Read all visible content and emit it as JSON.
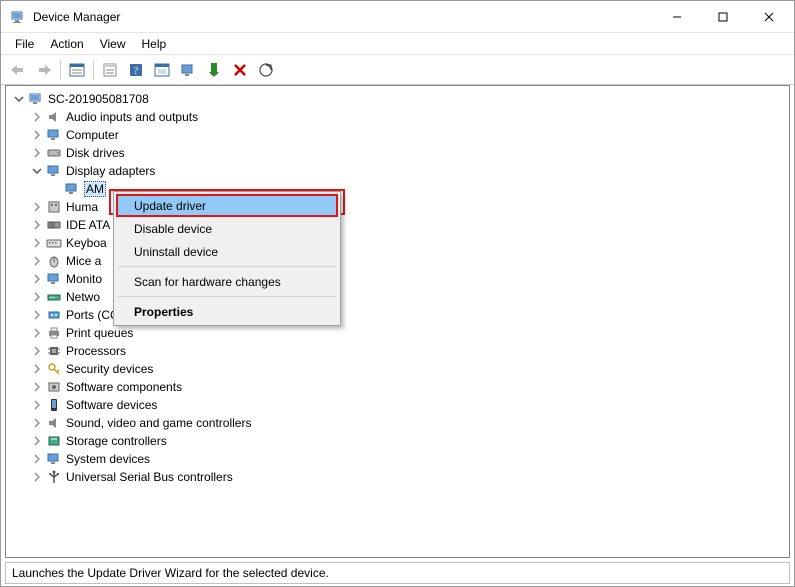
{
  "window": {
    "title": "Device Manager"
  },
  "menubar": [
    "File",
    "Action",
    "View",
    "Help"
  ],
  "toolbar_icons": [
    "back",
    "forward",
    "sep",
    "show-hidden",
    "sep",
    "properties",
    "help",
    "update",
    "monitor",
    "enable",
    "delete",
    "scan"
  ],
  "tree": {
    "root": {
      "label": "SC-201905081708",
      "expanded": true
    },
    "children": [
      {
        "label": "Audio inputs and outputs",
        "icon": "speaker"
      },
      {
        "label": "Computer",
        "icon": "monitor"
      },
      {
        "label": "Disk drives",
        "icon": "disk"
      },
      {
        "label": "Display adapters",
        "icon": "monitor",
        "expanded": true,
        "children": [
          {
            "label": "AM",
            "icon": "monitor",
            "selected": true
          }
        ]
      },
      {
        "label": "Huma",
        "icon": "hid"
      },
      {
        "label": "IDE ATA",
        "icon": "ide"
      },
      {
        "label": "Keyboa",
        "icon": "keyboard"
      },
      {
        "label": "Mice a",
        "icon": "mouse"
      },
      {
        "label": "Monito",
        "icon": "monitor"
      },
      {
        "label": "Netwo",
        "icon": "network"
      },
      {
        "label": "Ports (COM & LPT)",
        "icon": "port"
      },
      {
        "label": "Print queues",
        "icon": "printer"
      },
      {
        "label": "Processors",
        "icon": "cpu"
      },
      {
        "label": "Security devices",
        "icon": "security"
      },
      {
        "label": "Software components",
        "icon": "component"
      },
      {
        "label": "Software devices",
        "icon": "softdev"
      },
      {
        "label": "Sound, video and game controllers",
        "icon": "speaker"
      },
      {
        "label": "Storage controllers",
        "icon": "storage"
      },
      {
        "label": "System devices",
        "icon": "system"
      },
      {
        "label": "Universal Serial Bus controllers",
        "icon": "usb"
      }
    ]
  },
  "context_menu": {
    "items": [
      {
        "label": "Update driver",
        "highlight": true
      },
      {
        "label": "Disable device"
      },
      {
        "label": "Uninstall device"
      },
      {
        "sep": true
      },
      {
        "label": "Scan for hardware changes"
      },
      {
        "sep": true
      },
      {
        "label": "Properties",
        "bold": true
      }
    ]
  },
  "statusbar": "Launches the Update Driver Wizard for the selected device."
}
